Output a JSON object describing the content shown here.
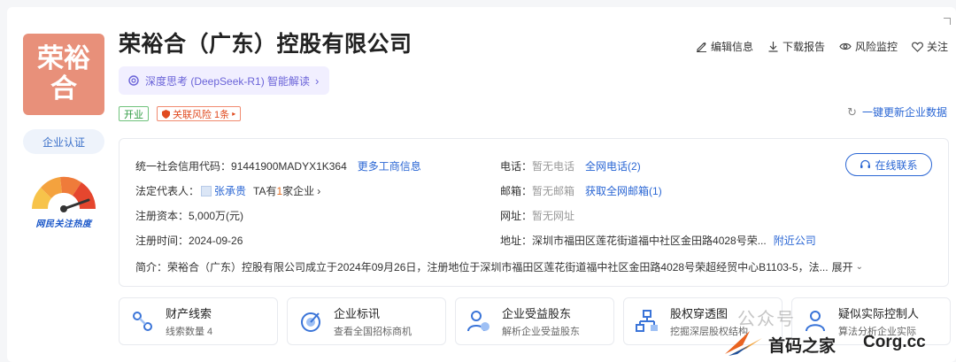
{
  "company": {
    "logo_text": "荣裕\n合",
    "name": "荣裕合（广东）控股有限公司",
    "ai_label": "深度思考 (DeepSeek-R1) 智能解读",
    "tag_status": "开业",
    "tag_risk": "关联风险 1条"
  },
  "side": {
    "cert_label": "企业认证",
    "heat_label": "网民关注热度"
  },
  "actions": {
    "edit": "编辑信息",
    "download": "下载报告",
    "monitor": "风险监控",
    "follow": "关注",
    "refresh": "一键更新企业数据"
  },
  "info": {
    "credit_code_label": "统一社会信用代码：",
    "credit_code": "91441900MADYX1K364",
    "more_business": "更多工商信息",
    "legal_rep_label": "法定代表人：",
    "legal_rep": "张承贵",
    "legal_rep_ta": "TA有",
    "legal_rep_count": "1",
    "legal_rep_suffix": "家企业",
    "capital_label": "注册资本：",
    "capital": "5,000万(元)",
    "reg_date_label": "注册时间：",
    "reg_date": "2024-09-26",
    "phone_label": "电话：",
    "phone": "暂无电话",
    "phone_all": "全网电话(2)",
    "email_label": "邮箱：",
    "email": "暂无邮箱",
    "email_all": "获取全网邮箱(1)",
    "website_label": "网址：",
    "website": "暂无网址",
    "address_label": "地址：",
    "address": "深圳市福田区莲花街道福中社区金田路4028号荣...",
    "nearby": "附近公司",
    "intro_label": "简介：",
    "intro": "荣裕合（广东）控股有限公司成立于2024年09月26日，注册地位于深圳市福田区莲花街道福中社区金田路4028号荣超经贸中心B1103-5，法...",
    "expand": "展开",
    "online_contact": "在线联系"
  },
  "tiles": [
    {
      "title": "财产线索",
      "sub": "线索数量 4",
      "icon": "property-icon"
    },
    {
      "title": "企业标讯",
      "sub": "查看全国招标商机",
      "icon": "bid-icon"
    },
    {
      "title": "企业受益股东",
      "sub": "解析企业受益股东",
      "icon": "shareholder-icon"
    },
    {
      "title": "股权穿透图",
      "sub": "挖掘深层股权结构",
      "icon": "equity-tree-icon"
    },
    {
      "title": "疑似实际控制人",
      "sub": "算法分析企业实际",
      "icon": "controller-icon"
    }
  ],
  "watermark": {
    "top": "公众号",
    "left": "首码之家",
    "right": "Corg.cc"
  },
  "colors": {
    "accent": "#2a66d4",
    "logo_bg": "#e8907a",
    "ai_bg": "#f1efff",
    "risk": "#e04a1f",
    "open": "#2e9a40"
  }
}
